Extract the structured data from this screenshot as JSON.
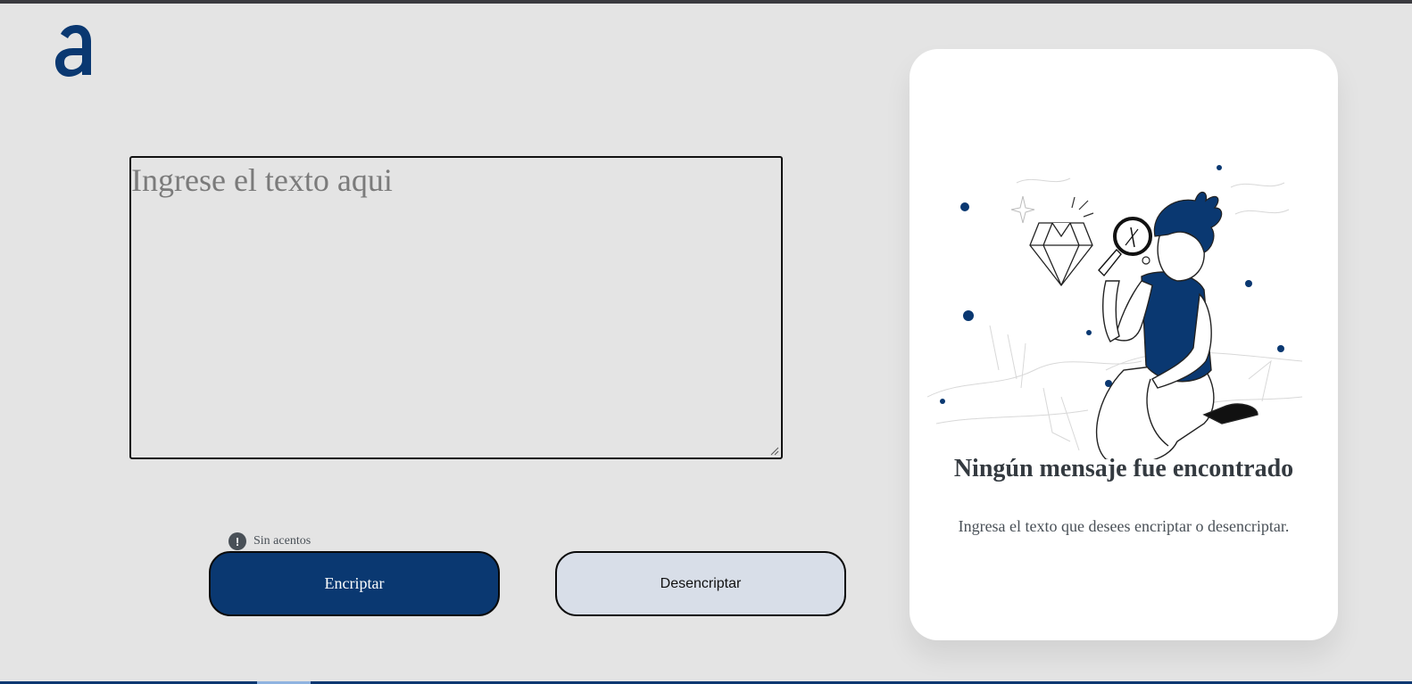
{
  "brand": {
    "logo_icon": "alura-a-logo-icon",
    "color": "#0a3871"
  },
  "input": {
    "placeholder": "Ingrese el texto aqui",
    "value": ""
  },
  "hint": {
    "icon": "exclamation-circle-icon",
    "text": "Sin acentos"
  },
  "buttons": {
    "encrypt_label": "Encriptar",
    "decrypt_label": "Desencriptar"
  },
  "output_panel": {
    "illustration": "person-with-magnifier-illustration",
    "title": "Ningún mensaje fue encontrado",
    "message": "Ingresa el texto que desees encriptar o desencriptar."
  },
  "colors": {
    "background": "#e4e4e4",
    "primary": "#0a3871",
    "secondary_button": "#d8dee8",
    "card": "#ffffff"
  }
}
